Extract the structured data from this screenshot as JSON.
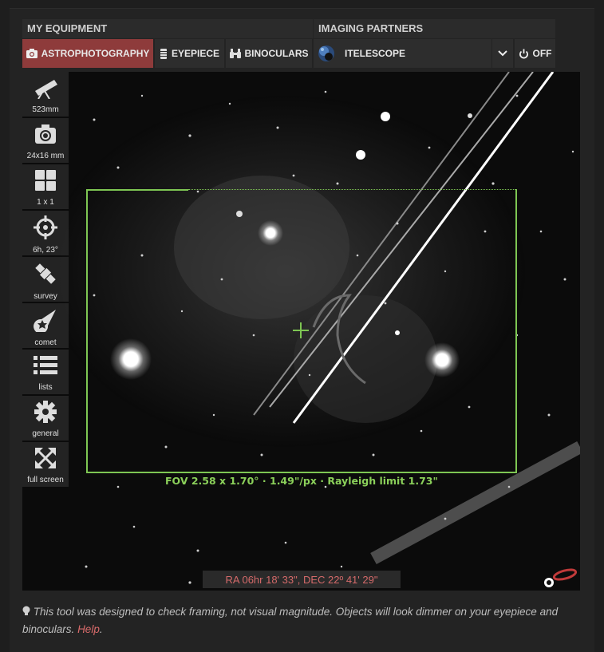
{
  "headers": {
    "equipment": "MY EQUIPMENT",
    "partners": "IMAGING PARTNERS"
  },
  "equipment_tabs": [
    {
      "label": "ASTROPHOTOGRAPHY",
      "icon": "camera-icon",
      "active": true
    },
    {
      "label": "EYEPIECE",
      "icon": "eyepiece-icon",
      "active": false
    },
    {
      "label": "BINOCULARS",
      "icon": "binoculars-icon",
      "active": false
    }
  ],
  "partner": {
    "label": "ITELESCOPE",
    "icon": "planet-logo-icon",
    "dropdown_icon": "chevron-down-icon"
  },
  "power": {
    "label": "OFF",
    "icon": "power-icon"
  },
  "tools": [
    {
      "label": "523mm",
      "icon": "telescope-icon"
    },
    {
      "label": "24x16 mm",
      "icon": "camera-icon"
    },
    {
      "label": "1 x 1",
      "icon": "mosaic-grid-icon"
    },
    {
      "label": "6h, 23°",
      "icon": "crosshair-icon"
    },
    {
      "label": "survey",
      "icon": "satellite-icon"
    },
    {
      "label": "comet",
      "icon": "comet-icon"
    },
    {
      "label": "lists",
      "icon": "list-icon"
    },
    {
      "label": "general",
      "icon": "gear-icon"
    },
    {
      "label": "full screen",
      "icon": "fullscreen-icon"
    }
  ],
  "fov_text": "FOV 2.58 x 1.70° · 1.49\"/px · Rayleigh limit 1.73\"",
  "coordinates": "RA 06hr 18' 33\", DEC 22º 41' 29\"",
  "note": {
    "text": "This tool was designed to check framing, not visual magnitude. Objects will look dimmer on your eyepiece and binoculars.",
    "link": "Help",
    "icon": "lightbulb-icon"
  },
  "colors": {
    "accent": "#8e3b3b",
    "fov": "#7ec653",
    "link": "#d96b6b"
  }
}
